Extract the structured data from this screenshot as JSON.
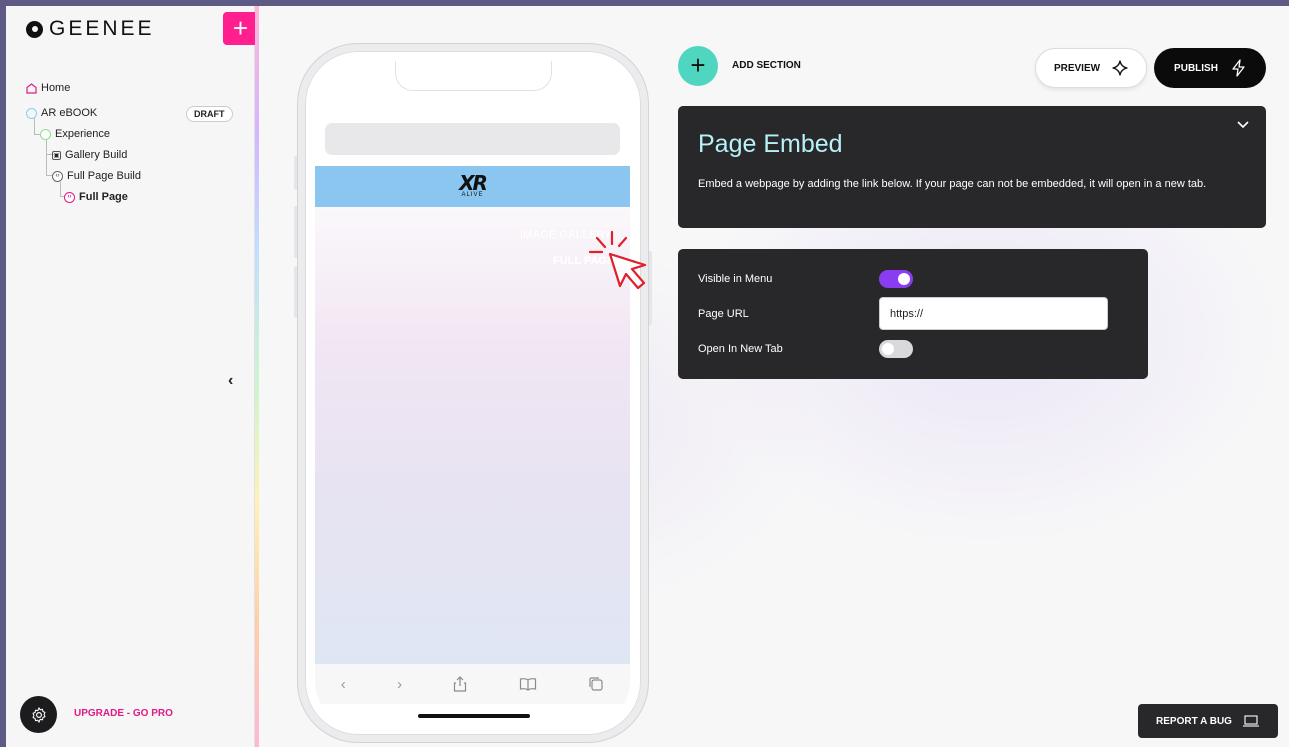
{
  "app": {
    "logo_text": "GEENEE",
    "add_label": "+"
  },
  "sidebar": {
    "tree": [
      {
        "label": "Home",
        "icon": "home-icon"
      },
      {
        "label": "AR eBOOK",
        "icon": "circle-icon",
        "badge": "DRAFT"
      },
      {
        "label": "Experience",
        "icon": "circle-icon"
      },
      {
        "label": "Gallery Build",
        "icon": "gallery-icon"
      },
      {
        "label": "Full Page Build",
        "icon": "code-icon"
      },
      {
        "label": "Full Page",
        "icon": "code-icon"
      }
    ],
    "collapse_glyph": "‹",
    "upgrade_label": "UPGRADE - GO PRO"
  },
  "phone": {
    "banner_logo": "XR",
    "banner_sub": "ALIVE",
    "menu_items": [
      "IMAGE GALLERY",
      "FULL PAGE"
    ]
  },
  "toolbar": {
    "add_section_label": "ADD SECTION",
    "preview_label": "PREVIEW",
    "publish_label": "PUBLISH"
  },
  "embed": {
    "title": "Page Embed",
    "description": "Embed a webpage by adding the link below. If your page can not be embedded, it will open in a new tab."
  },
  "settings": {
    "visible_label": "Visible in Menu",
    "visible_on": true,
    "url_label": "Page URL",
    "url_value": "https://",
    "newtab_label": "Open In New Tab",
    "newtab_on": false
  },
  "report_label": "REPORT A BUG",
  "colors": {
    "accent_pink": "#ff1f8f",
    "toggle_on": "#8a3df0",
    "teal": "#4fd6c0",
    "card": "#28282b",
    "title_cyan": "#b7f0f6"
  }
}
